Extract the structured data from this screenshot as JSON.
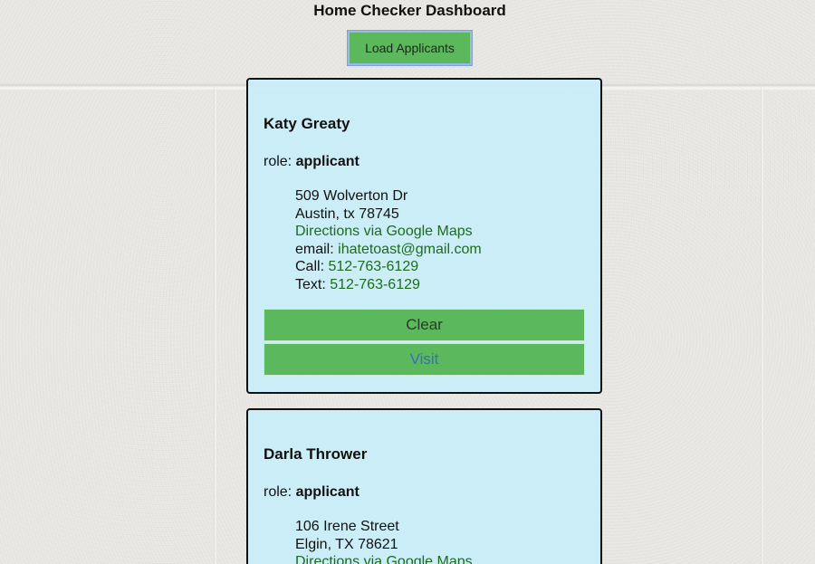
{
  "header": {
    "title": "Home Checker Dashboard",
    "load_button_label": "Load Applicants"
  },
  "applicants": [
    {
      "name": "Katy Greaty",
      "role_label": "role:",
      "role": "applicant",
      "address_line1": "509 Wolverton Dr",
      "address_line2": "Austin, tx 78745",
      "directions_label": "Directions via Google Maps",
      "email_label": "email:",
      "email": "ihatetoast@gmail.com",
      "call_label": "Call:",
      "phone": "512-763-6129",
      "text_label": "Text:",
      "text_phone": "512-763-6129",
      "clear_label": "Clear",
      "visit_label": "Visit"
    },
    {
      "name": "Darla Thrower",
      "role_label": "role:",
      "role": "applicant",
      "address_line1": "106 Irene Street",
      "address_line2": "Elgin, TX 78621",
      "directions_label": "Directions via Google Maps"
    }
  ]
}
